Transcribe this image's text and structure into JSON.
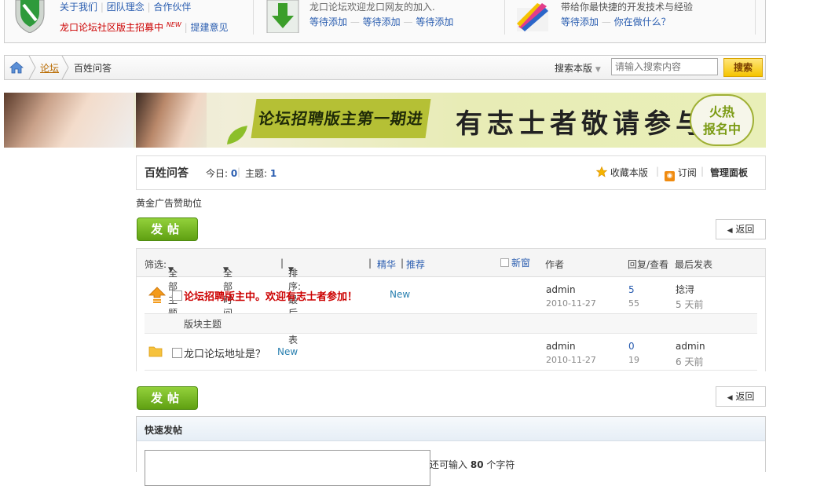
{
  "promo": {
    "col1": {
      "links": [
        "关于我们",
        "团队理念",
        "合作伙伴"
      ],
      "recruit": "龙口论坛社区版主招募中",
      "new_badge": "NEW",
      "feedback": "提建意见"
    },
    "col2": {
      "welcome": "龙口论坛欢迎龙口网友的加入.",
      "waits": [
        "等待添加",
        "等待添加",
        "等待添加"
      ]
    },
    "col3": {
      "desc": "带给你最快捷的开发技术与经验",
      "wait": "等待添加",
      "question": "你在做什么？"
    }
  },
  "breadcrumb": {
    "forum": "论坛",
    "current": "百姓问答"
  },
  "search": {
    "scope": "搜索本版",
    "placeholder": "请输入搜索内容",
    "button": "搜索"
  },
  "banner": {
    "tag": "论坛招聘版主第一期进行中",
    "slogan": "有志士者敬请参与",
    "badge_line1": "火热",
    "badge_line2": "报名中"
  },
  "forum": {
    "title": "百姓问答",
    "today_label": "今日:",
    "today_value": "0",
    "topics_label": "主题:",
    "topics_value": "1",
    "favorite": "收藏本版",
    "subscribe": "订阅",
    "admin_panel": "管理面板"
  },
  "ad_text": "黄金广告赞助位",
  "buttons": {
    "post": "发帖",
    "back": "返回"
  },
  "list_header": {
    "filter_label": "筛选:",
    "all_topics": "全部主题",
    "all_time": "全部时间",
    "sort": "排序: 最后发表",
    "digest": "精华",
    "recommend": "推荐",
    "new_window": "新窗",
    "author": "作者",
    "replies_views": "回复/查看",
    "last_post": "最后发表"
  },
  "threads": [
    {
      "title": "论坛招聘版主中。欢迎有志士者参加！",
      "new_label": "New",
      "author": "admin",
      "date": "2010-11-27",
      "replies": "5",
      "views": "55",
      "last_user": "捻浔",
      "last_time": "5 天前"
    },
    {
      "title": "龙口论坛地址是？",
      "new_label": "New",
      "author": "admin",
      "date": "2010-11-27",
      "replies": "0",
      "views": "19",
      "last_user": "admin",
      "last_time": "6 天前"
    }
  ],
  "section_label": "版块主题",
  "quick_post": {
    "title": "快速发帖",
    "hint_prefix": "还可输入",
    "hint_count": "80",
    "hint_suffix": "个字符"
  },
  "colors": {
    "link_blue": "#2a5db0",
    "sticky_red": "#c00",
    "post_green": "#5fa012",
    "search_yellow": "#f5c400"
  }
}
